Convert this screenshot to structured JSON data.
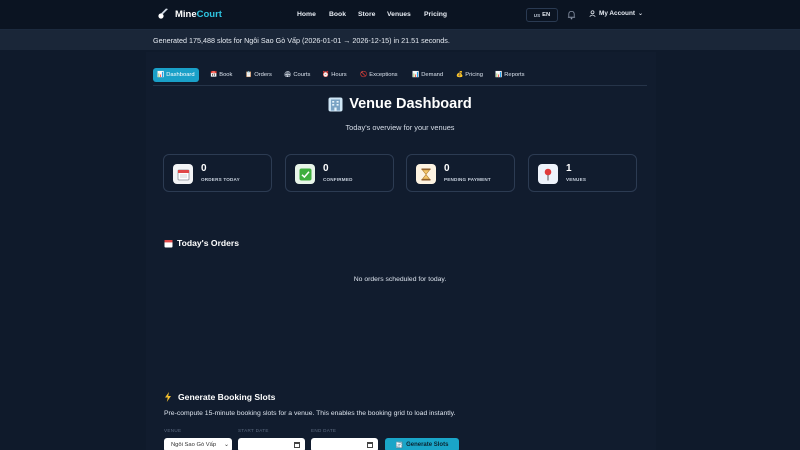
{
  "app": {
    "brand_prefix": "Mine",
    "brand_suffix": "Court"
  },
  "nav": {
    "home": "Home",
    "book": "Book",
    "store": "Store",
    "venues": "Venues",
    "pricing": "Pricing"
  },
  "lang": {
    "flag": "US",
    "code": "EN"
  },
  "account": {
    "label": "My Account"
  },
  "banner": {
    "text": "Generated 175,488 slots for Ngôi Sao Gò Vấp (2026-01-01 → 2026-12-15) in 21.51 seconds."
  },
  "tabs": [
    {
      "label": "Dashboard",
      "icon": "📊"
    },
    {
      "label": "Book",
      "icon": "📅"
    },
    {
      "label": "Orders",
      "icon": "📋"
    },
    {
      "label": "Courts",
      "icon": "🏟"
    },
    {
      "label": "Hours",
      "icon": "⏰"
    },
    {
      "label": "Exceptions",
      "icon": "🚫"
    },
    {
      "label": "Demand",
      "icon": "📊"
    },
    {
      "label": "Pricing",
      "icon": "💰"
    },
    {
      "label": "Reports",
      "icon": "📊"
    }
  ],
  "page": {
    "title": "Venue Dashboard",
    "subtitle": "Today's overview for your venues"
  },
  "stats": [
    {
      "value": "0",
      "label": "ORDERS TODAY",
      "icon": "calendar-icon",
      "bg": "#f3f4f6"
    },
    {
      "value": "0",
      "label": "CONFIRMED",
      "icon": "check-icon",
      "bg": "#e8f5e9"
    },
    {
      "value": "0",
      "label": "PENDING PAYMENT",
      "icon": "hourglass-icon",
      "bg": "#fdf3e2"
    },
    {
      "value": "1",
      "label": "VENUES",
      "icon": "pin-icon",
      "bg": "#eef3fb"
    }
  ],
  "orders": {
    "title": "Today's Orders",
    "empty": "No orders scheduled for today."
  },
  "generate": {
    "title": "Generate Booking Slots",
    "description": "Pre-compute 15-minute booking slots for a venue. This enables the booking grid to load instantly.",
    "venue_label": "VENUE",
    "venue_value": "Ngôi Sao Gò Vấp",
    "start_label": "START DATE",
    "end_label": "END DATE",
    "button": "Generate Slots"
  },
  "colors": {
    "accent": "#1aa5c8",
    "background": "#0f1a2b",
    "panel": "#111c2e"
  }
}
